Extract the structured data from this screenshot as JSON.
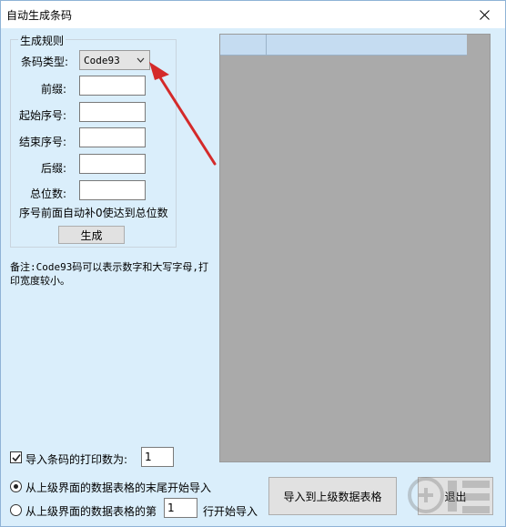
{
  "window": {
    "title": "自动生成条码"
  },
  "rules": {
    "group_title": "生成规则",
    "barcode_type_label": "条码类型:",
    "barcode_type_value": "Code93",
    "prefix_label": "前缀:",
    "prefix_value": "",
    "start_label": "起始序号:",
    "start_value": "",
    "end_label": "结束序号:",
    "end_value": "",
    "suffix_label": "后缀:",
    "suffix_value": "",
    "digits_label": "总位数:",
    "digits_value": "",
    "hint": "序号前面自动补0使达到总位数",
    "generate_button": "生成"
  },
  "note": "备注:Code93码可以表示数字和大写字母,打印宽度较小。",
  "bottom": {
    "print_count_label": "导入条码的打印数为:",
    "print_count_value": "1",
    "print_count_checked": true,
    "import_from_end_label": "从上级界面的数据表格的末尾开始导入",
    "import_from_row_prefix": "从上级界面的数据表格的第",
    "import_from_row_value": "1",
    "import_from_row_suffix": "行开始导入",
    "selected_mode": "end",
    "import_button": "导入到上级数据表格",
    "exit_button": "退出"
  },
  "icons": {
    "close": "close-icon",
    "dropdown": "chevron-down-icon",
    "check": "check-icon",
    "watermark": "logo-watermark"
  },
  "colors": {
    "window_bg": "#daeefb",
    "grid_bg": "#aaaaaa",
    "grid_header": "#c5dcf1",
    "arrow": "#d42a2a"
  }
}
